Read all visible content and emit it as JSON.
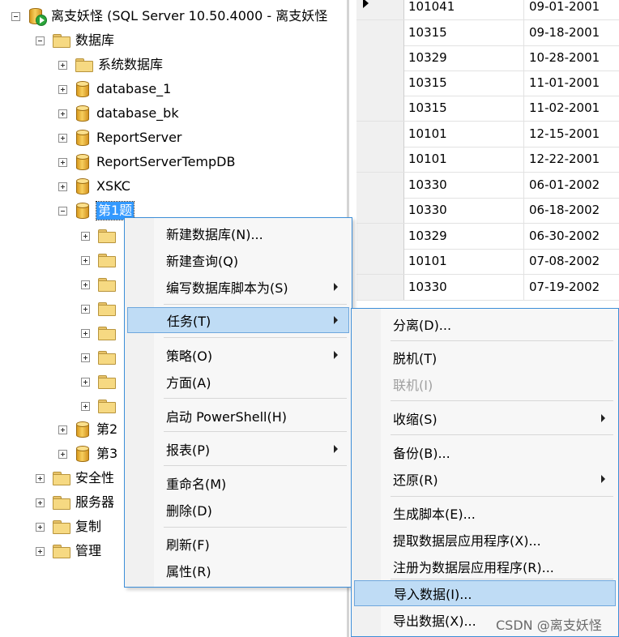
{
  "tree": {
    "server": "离支妖怪 (SQL Server 10.50.4000 - 离支妖怪",
    "databases": "数据库",
    "system_dbs": "系统数据库",
    "db1": "database_1",
    "db2": "database_bk",
    "db3": "ReportServer",
    "db4": "ReportServerTempDB",
    "db5": "XSKC",
    "db6": "第1题",
    "db7": "第2",
    "db8": "第3",
    "security": "安全性",
    "server_objects": "服务器",
    "replication": "复制",
    "management": "管理"
  },
  "grid": {
    "rows": [
      [
        "101041",
        "09-01-2001"
      ],
      [
        "10315",
        "09-18-2001"
      ],
      [
        "10329",
        "10-28-2001"
      ],
      [
        "10315",
        "11-01-2001"
      ],
      [
        "10315",
        "11-02-2001"
      ],
      [
        "10101",
        "12-15-2001"
      ],
      [
        "10101",
        "12-22-2001"
      ],
      [
        "10330",
        "06-01-2002"
      ],
      [
        "10330",
        "06-18-2002"
      ],
      [
        "10329",
        "06-30-2002"
      ],
      [
        "10101",
        "07-08-2002"
      ],
      [
        "10330",
        "07-19-2002"
      ]
    ]
  },
  "menu": {
    "new_db": "新建数据库(N)...",
    "new_query": "新建查询(Q)",
    "script_db": "编写数据库脚本为(S)",
    "tasks": "任务(T)",
    "policies": "策略(O)",
    "facets": "方面(A)",
    "powershell": "启动 PowerShell(H)",
    "reports": "报表(P)",
    "rename": "重命名(M)",
    "delete": "删除(D)",
    "refresh": "刷新(F)",
    "properties": "属性(R)"
  },
  "submenu": {
    "detach": "分离(D)...",
    "offline": "脱机(T)",
    "online": "联机(I)",
    "shrink": "收缩(S)",
    "backup": "备份(B)...",
    "restore": "还原(R)",
    "gen_scripts": "生成脚本(E)...",
    "extract_dac": "提取数据层应用程序(X)...",
    "register_dac": "注册为数据层应用程序(R)...",
    "import_data": "导入数据(I)...",
    "export_data": "导出数据(X)..."
  },
  "watermark": "CSDN @离支妖怪"
}
